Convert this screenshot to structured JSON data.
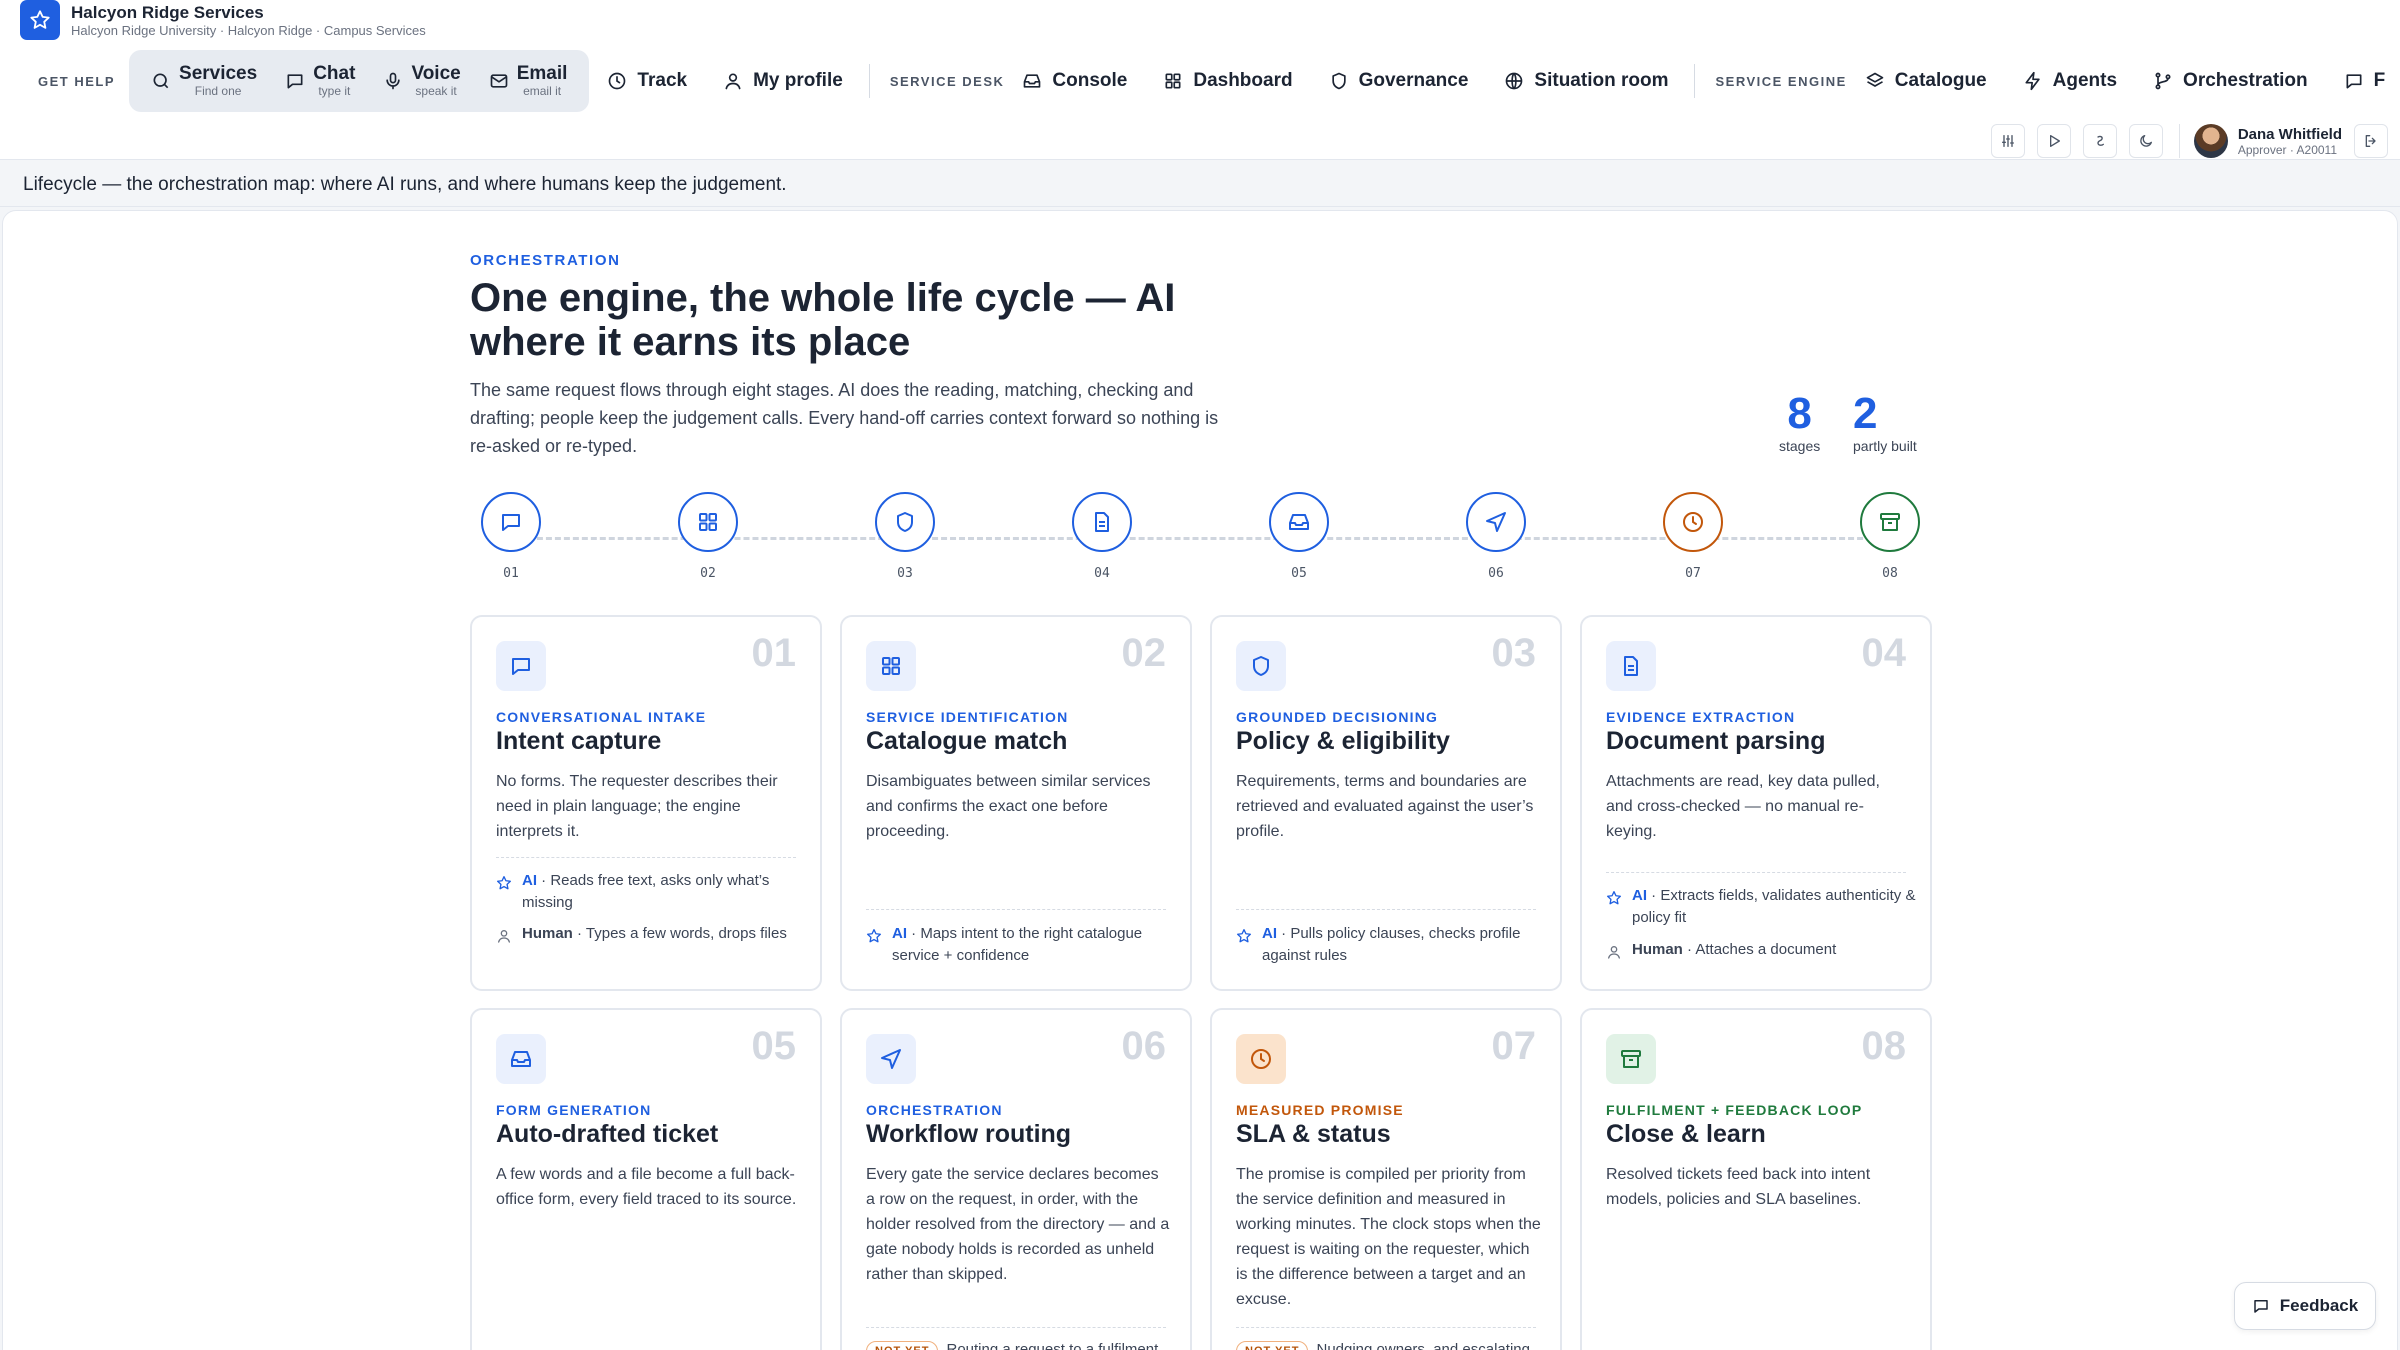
{
  "brand": {
    "name": "Halcyon Ridge Services",
    "subtitle": "Halcyon Ridge University · Halcyon Ridge · Campus Services"
  },
  "nav": {
    "get_help_label": "GET HELP",
    "channels": [
      {
        "title": "Services",
        "sub": "Find one",
        "icon": "search-icon"
      },
      {
        "title": "Chat",
        "sub": "type it",
        "icon": "chat-icon"
      },
      {
        "title": "Voice",
        "sub": "speak it",
        "icon": "microphone-icon"
      },
      {
        "title": "Email",
        "sub": "email it",
        "icon": "mail-icon"
      }
    ],
    "track": "Track",
    "my_profile": "My profile",
    "service_desk_label": "SERVICE DESK",
    "console": "Console",
    "dashboard": "Dashboard",
    "governance": "Governance",
    "situation_room": "Situation room",
    "service_engine_label": "SERVICE ENGINE",
    "catalogue": "Catalogue",
    "agents": "Agents",
    "orchestration": "Orchestration",
    "overflow": "F"
  },
  "user": {
    "name": "Dana Whitfield",
    "role": "Approver · A20011"
  },
  "breadcrumb": "Lifecycle — the orchestration map: where AI runs, and where humans keep the judgement.",
  "hero": {
    "eyebrow": "ORCHESTRATION",
    "title": "One engine, the whole life cycle — AI where it earns its place",
    "description": "The same request flows through eight stages. AI does the reading, matching, checking and drafting; people keep the judgement calls. Every hand-off carries context forward so nothing is re-asked or re-typed."
  },
  "stats": [
    {
      "value": "8",
      "caption": "stages"
    },
    {
      "value": "2",
      "caption": "partly built"
    }
  ],
  "timeline": [
    {
      "num": "01",
      "icon": "chat-icon",
      "color": "#1f5fe0"
    },
    {
      "num": "02",
      "icon": "grid-icon",
      "color": "#1f5fe0"
    },
    {
      "num": "03",
      "icon": "shield-icon",
      "color": "#1f5fe0"
    },
    {
      "num": "04",
      "icon": "document-icon",
      "color": "#1f5fe0"
    },
    {
      "num": "05",
      "icon": "inbox-icon",
      "color": "#1f5fe0"
    },
    {
      "num": "06",
      "icon": "send-icon",
      "color": "#1f5fe0"
    },
    {
      "num": "07",
      "icon": "clock-icon",
      "color": "#c2570b"
    },
    {
      "num": "08",
      "icon": "archive-icon",
      "color": "#1f7a3d"
    }
  ],
  "colors": {
    "accent": "#1f5fe0",
    "sla": "#c2570b",
    "fulfilment": "#1f7a3d"
  },
  "cards": [
    {
      "num": "01",
      "kicker": "CONVERSATIONAL INTAKE",
      "title": "Intent capture",
      "desc": "No forms. The requester describes their need in plain language; the engine interprets it.",
      "ai_label": "AI",
      "ai": "· Reads free text, asks only what’s missing",
      "human_label": "Human",
      "human": "· Types a few words, drops files"
    },
    {
      "num": "02",
      "kicker": "SERVICE IDENTIFICATION",
      "title": "Catalogue match",
      "desc": "Disambiguates between similar services and confirms the exact one before proceeding.",
      "ai_label": "AI",
      "ai": "· Maps intent to the right catalogue service + confidence"
    },
    {
      "num": "03",
      "kicker": "GROUNDED DECISIONING",
      "title": "Policy & eligibility",
      "desc": "Requirements, terms and boundaries are retrieved and evaluated against the user’s profile.",
      "ai_label": "AI",
      "ai": "· Pulls policy clauses, checks profile against rules"
    },
    {
      "num": "04",
      "kicker": "EVIDENCE EXTRACTION",
      "title": "Document parsing",
      "desc": "Attachments are read, key data pulled, and cross-checked — no manual re-keying.",
      "ai_label": "AI",
      "ai": "· Extracts fields, validates authenticity & policy fit",
      "human_label": "Human",
      "human": "· Attaches a document"
    },
    {
      "num": "05",
      "kicker": "FORM GENERATION",
      "title": "Auto-drafted ticket",
      "desc": "A few words and a file become a full back-office form, every field traced to its source."
    },
    {
      "num": "06",
      "kicker": "ORCHESTRATION",
      "title": "Workflow routing",
      "desc": "Every gate the service declares becomes a row on the request, in order, with the holder resolved from the directory — and a gate nobody holds is recorded as unheld rather than skipped.",
      "badge": "NOT YET",
      "badge_text": "Routing a request to a fulfilment"
    },
    {
      "num": "07",
      "kicker": "MEASURED PROMISE",
      "title": "SLA & status",
      "desc": "The promise is compiled per priority from the service definition and measured in working minutes. The clock stops when the request is waiting on the requester, which is the difference between a target and an excuse.",
      "badge": "NOT YET",
      "badge_text": "Nudging owners, and escalating"
    },
    {
      "num": "08",
      "kicker": "FULFILMENT + FEEDBACK LOOP",
      "title": "Close & learn",
      "desc": "Resolved tickets feed back into intent models, policies and SLA baselines."
    }
  ],
  "feedback": "Feedback"
}
